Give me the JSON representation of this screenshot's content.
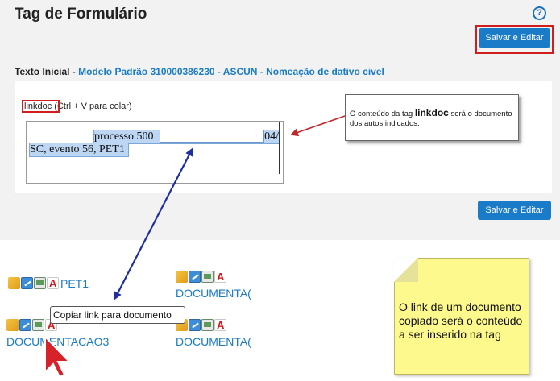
{
  "header": {
    "title": "Tag de Formulário",
    "help_glyph": "?"
  },
  "toolbar": {
    "save_edit_label": "Salvar e Editar"
  },
  "form": {
    "heading_label": "Texto Inicial - ",
    "heading_link": "Modelo Padrão 310000386230 - ASCUN - Nomeação de dativo civel",
    "tag_name": "linkdoc",
    "tag_hint": " (Ctrl + V para colar)",
    "editor_line1": "processo  500",
    "editor_line1_end": "04/",
    "editor_line2": "SC, evento 56, PET1"
  },
  "callout": {
    "text_before": "O conteúdo da tag ",
    "tag": "linkdoc",
    "text_after": " será o documento dos autos indicados."
  },
  "documents": {
    "items": [
      {
        "label": "PET1"
      },
      {
        "label": "DOCUMENTA("
      },
      {
        "label": "DOCUMENTACAO3"
      },
      {
        "label": "DOCUMENTA("
      }
    ],
    "tooltip": "Copiar link para documento"
  },
  "note": {
    "text": "O link de um documento copiado será o conteúdo a ser inserido na tag"
  },
  "colors": {
    "accent": "#1a7bc8",
    "highlight": "#d01e1e",
    "note_bg": "#fdf98c",
    "arrow": "#1f2f9e"
  }
}
